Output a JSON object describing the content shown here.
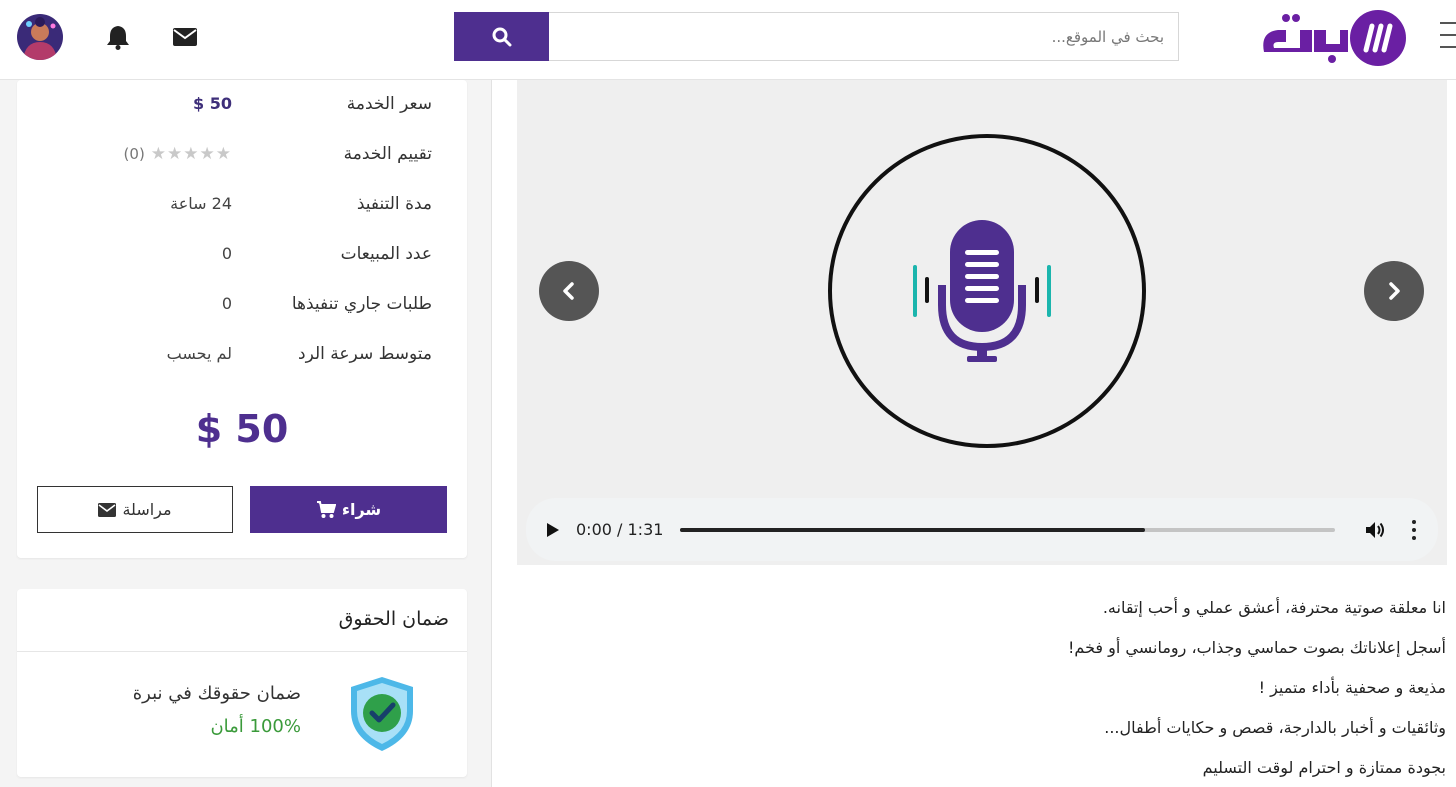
{
  "header": {
    "logo_text": "نبرة",
    "search_placeholder": "بحث في الموقع...",
    "icons": [
      "menu-icon",
      "search-icon",
      "envelope-icon",
      "bell-icon",
      "avatar"
    ],
    "brand_color": "#4e2f8f"
  },
  "service_info": {
    "rows": [
      {
        "label": "سعر الخدمة",
        "value": "50 $"
      },
      {
        "label": "تقييم الخدمة",
        "value": "(0)",
        "stars": "★★★★★"
      },
      {
        "label": "مدة التنفيذ",
        "value": "24 ساعة"
      },
      {
        "label": "عدد المبيعات",
        "value": "0"
      },
      {
        "label": "طلبات جاري تنفيذها",
        "value": "0"
      },
      {
        "label": "متوسط سرعة الرد",
        "value": "لم يحسب"
      }
    ],
    "big_price": "$ 50",
    "buy_label": "شراء",
    "message_label": "مراسلة"
  },
  "guarantee": {
    "title": "ضمان الحقوق",
    "line1": "ضمان حقوقك في نبرة",
    "line2": "100% أمان",
    "success_color": "#3a9a3a"
  },
  "player": {
    "time": "0:00 / 1:31",
    "progress": 0.71,
    "prev_icon": "chevron-left-icon",
    "next_icon": "chevron-right-icon",
    "media_icon": "microphone-icon"
  },
  "description": [
    "انا معلقة صوتية محترفة، أعشق عملي و أحب إتقانه.",
    "أسجل إعلاناتك بصوت حماسي وجذاب، رومانسي أو فخم!",
    "مذيعة و صحفية بأداء متميز !",
    "وثائقيات و أخبار بالدارجة، قصص و حكايات أطفال...",
    "بجودة ممتازة و احترام لوقت التسليم"
  ]
}
